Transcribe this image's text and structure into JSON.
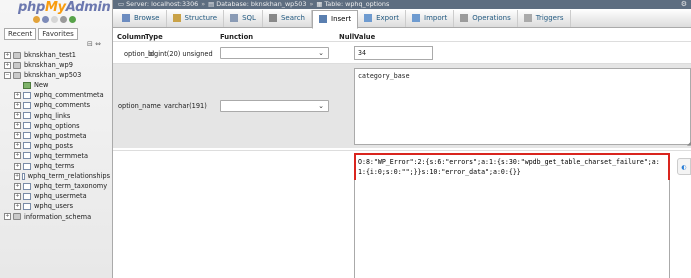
{
  "logo": {
    "part1": "php",
    "part2": "My",
    "part3": "Admin"
  },
  "nav_icons": [
    {
      "name": "home-icon",
      "color": "#e2a33b"
    },
    {
      "name": "exit-icon",
      "color": "#7d8bb8"
    },
    {
      "name": "docs-icon",
      "color": "#d6d6d6"
    },
    {
      "name": "settings-icon",
      "color": "#9a9a9a"
    },
    {
      "name": "reload-icon",
      "color": "#58a34a"
    }
  ],
  "nav_tabs": {
    "recent": "Recent",
    "favorites": "Favorites"
  },
  "tree": [
    {
      "label": "bknskhan_test1",
      "level": 1,
      "exp": "+",
      "icon": "db"
    },
    {
      "label": "bknskhan_wp9",
      "level": 1,
      "exp": "+",
      "icon": "db"
    },
    {
      "label": "bknskhan_wp503",
      "level": 1,
      "exp": "−",
      "icon": "db"
    },
    {
      "label": "New",
      "level": 2,
      "exp": "",
      "icon": "new"
    },
    {
      "label": "wphq_commentmeta",
      "level": 3,
      "exp": "+",
      "icon": "tbl"
    },
    {
      "label": "wphq_comments",
      "level": 3,
      "exp": "+",
      "icon": "tbl"
    },
    {
      "label": "wphq_links",
      "level": 3,
      "exp": "+",
      "icon": "tbl"
    },
    {
      "label": "wphq_options",
      "level": 3,
      "exp": "+",
      "icon": "tbl"
    },
    {
      "label": "wphq_postmeta",
      "level": 3,
      "exp": "+",
      "icon": "tbl"
    },
    {
      "label": "wphq_posts",
      "level": 3,
      "exp": "+",
      "icon": "tbl"
    },
    {
      "label": "wphq_termmeta",
      "level": 3,
      "exp": "+",
      "icon": "tbl"
    },
    {
      "label": "wphq_terms",
      "level": 3,
      "exp": "+",
      "icon": "tbl"
    },
    {
      "label": "wphq_term_relationships",
      "level": 3,
      "exp": "+",
      "icon": "tbl"
    },
    {
      "label": "wphq_term_taxonomy",
      "level": 3,
      "exp": "+",
      "icon": "tbl"
    },
    {
      "label": "wphq_usermeta",
      "level": 3,
      "exp": "+",
      "icon": "tbl"
    },
    {
      "label": "wphq_users",
      "level": 3,
      "exp": "+",
      "icon": "tbl"
    },
    {
      "label": "information_schema",
      "level": 1,
      "exp": "+",
      "icon": "db"
    }
  ],
  "breadcrumb": {
    "server": "Server: localhost:3306",
    "database": "Database: bknskhan_wp503",
    "table": "Table: wphq_options"
  },
  "tabs": [
    {
      "label": "Browse",
      "icon": "browse-icon",
      "color": "#6c8cc0"
    },
    {
      "label": "Structure",
      "icon": "structure-icon",
      "color": "#c9a247"
    },
    {
      "label": "SQL",
      "icon": "sql-icon",
      "color": "#8a9bb5"
    },
    {
      "label": "Search",
      "icon": "search-icon",
      "color": "#888888"
    },
    {
      "label": "Insert",
      "icon": "insert-icon",
      "color": "#5a7fb0",
      "active": true
    },
    {
      "label": "Export",
      "icon": "export-icon",
      "color": "#6e9bd0"
    },
    {
      "label": "Import",
      "icon": "import-icon",
      "color": "#6e9bd0"
    },
    {
      "label": "Operations",
      "icon": "operations-icon",
      "color": "#9b9b9b"
    },
    {
      "label": "Triggers",
      "icon": "triggers-icon",
      "color": "#aaaaaa"
    }
  ],
  "columns_header": {
    "column": "Column",
    "type": "Type",
    "function": "Function",
    "null": "Null",
    "value": "Value"
  },
  "rows": [
    {
      "column": "option_id",
      "type": "bigint(20) unsigned",
      "function": "",
      "value": "34"
    },
    {
      "column": "option_name",
      "type": "varchar(191)",
      "function": "",
      "value": "category_base"
    },
    {
      "column": "",
      "type": "",
      "function": "",
      "value": "O:8:\"WP_Error\":2:{s:6:\"errors\";a:1:{s:30:\"wpdb_get_table_charset_failure\";a:1:{i:0;s:0:\"\";}}s:10:\"error_data\";a:0:{}}"
    }
  ],
  "accent": {
    "highlight": "#d9251e",
    "row_alt": "#e5e5e5"
  }
}
